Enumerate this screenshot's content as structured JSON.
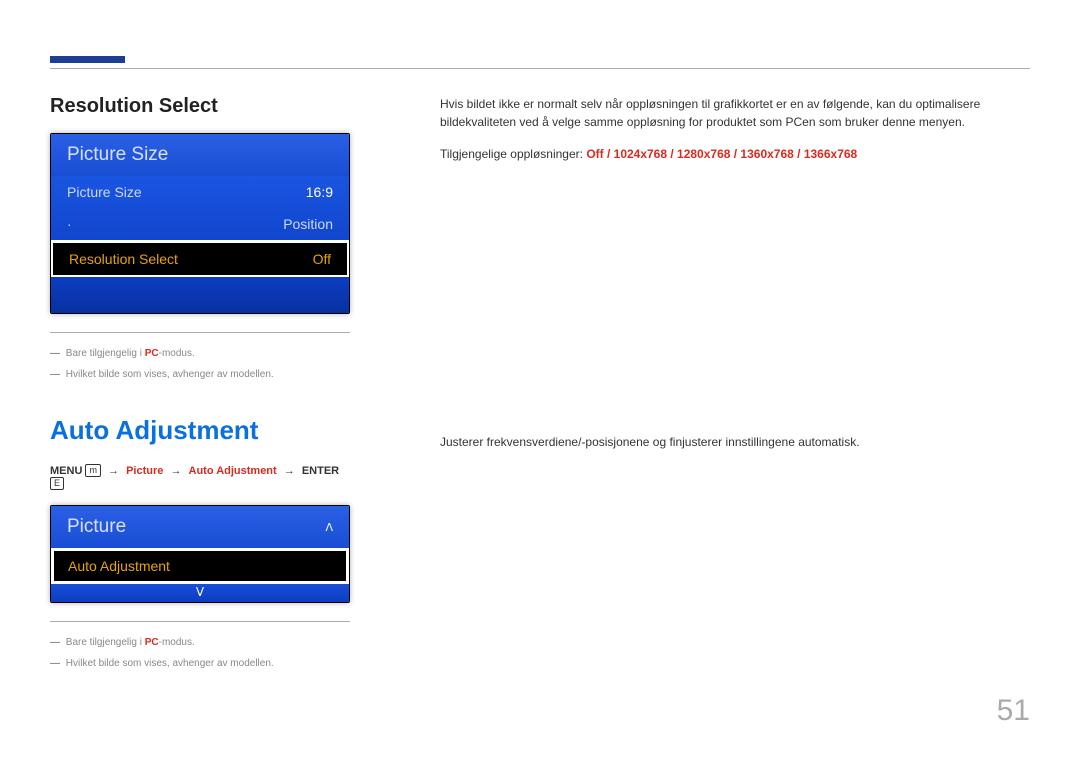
{
  "page_number": "51",
  "section1": {
    "heading": "Resolution Select",
    "osd": {
      "title": "Picture Size",
      "rows": [
        {
          "label": "Picture Size",
          "value": "16:9",
          "selected": false,
          "sub": false
        },
        {
          "label": "Position",
          "value": "",
          "selected": false,
          "sub": true
        },
        {
          "label": "Resolution Select",
          "value": "Off",
          "selected": true,
          "sub": false
        }
      ]
    },
    "notes": [
      {
        "pre": "Bare tilgjengelig i ",
        "hl": "PC",
        "post": "-modus."
      },
      {
        "pre": "Hvilket bilde som vises, avhenger av modellen.",
        "hl": "",
        "post": ""
      }
    ],
    "desc": "Hvis bildet ikke er normalt selv når oppløsningen til grafikkortet er en av følgende, kan du optimalisere bildekvaliteten ved å velge samme oppløsning for produktet som PCen som bruker denne menyen.",
    "avail_label": "Tilgjengelige oppløsninger: ",
    "avail_values": "Off / 1024x768 / 1280x768 / 1360x768 / 1366x768"
  },
  "section2": {
    "heading": "Auto Adjustment",
    "path": {
      "menu": "MENU",
      "p1": "Picture",
      "p2": "Auto Adjustment",
      "enter": "ENTER",
      "menu_icon": "m",
      "enter_icon": "E"
    },
    "osd": {
      "title": "Picture",
      "selected": "Auto Adjustment",
      "up": "ᐱ",
      "down": "ᐯ"
    },
    "notes": [
      {
        "pre": "Bare tilgjengelig i ",
        "hl": "PC",
        "post": "-modus."
      },
      {
        "pre": "Hvilket bilde som vises, avhenger av modellen.",
        "hl": "",
        "post": ""
      }
    ],
    "desc": "Justerer frekvensverdiene/-posisjonene og finjusterer innstillingene automatisk."
  }
}
